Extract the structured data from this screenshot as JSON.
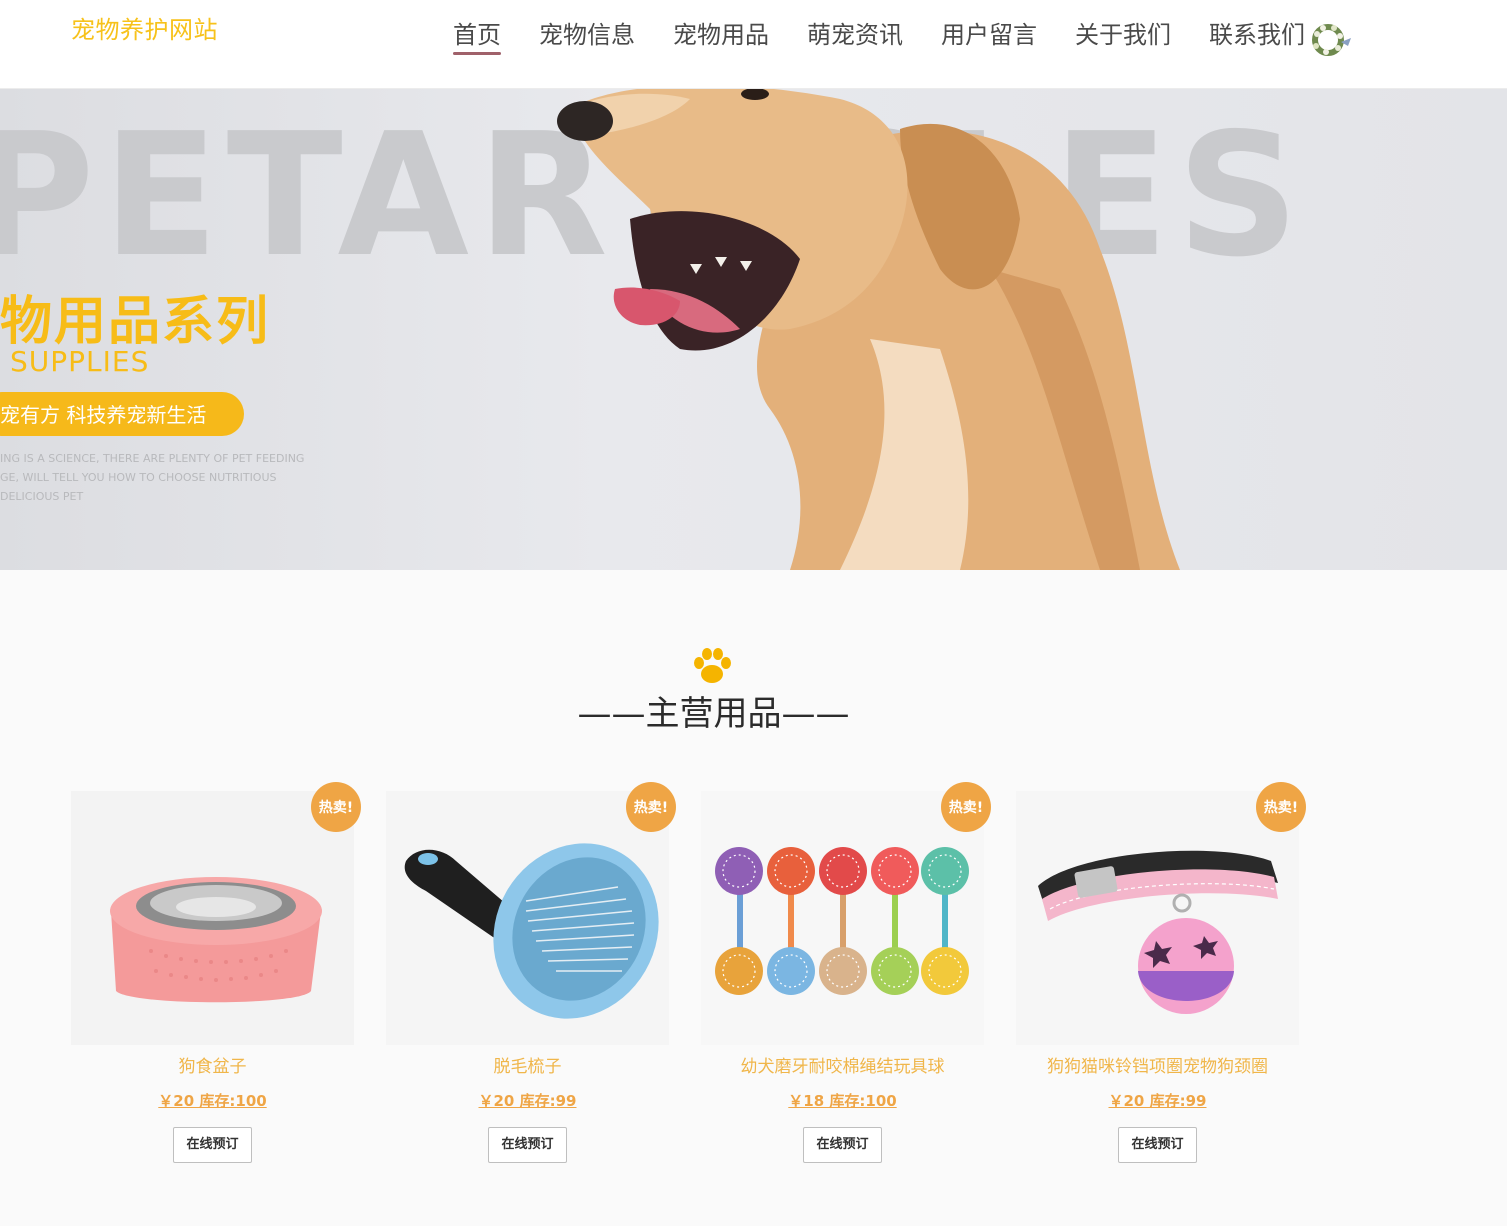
{
  "header": {
    "site_title": "宠物养护网站",
    "nav": [
      {
        "label": "首页",
        "active": true
      },
      {
        "label": "宠物信息",
        "active": false
      },
      {
        "label": "宠物用品",
        "active": false
      },
      {
        "label": "萌宠资讯",
        "active": false
      },
      {
        "label": "用户留言",
        "active": false
      },
      {
        "label": "关于我们",
        "active": false
      },
      {
        "label": "联系我们",
        "active": false
      }
    ]
  },
  "banner": {
    "big_word": "PETARTICLES",
    "cn_title": "物用品系列",
    "en_title": "SUPPLIES",
    "pill_text": "宠有方  科技养宠新生活",
    "small_lines": [
      "ING IS A SCIENCE, THERE ARE PLENTY OF PET FEEDING",
      "GE, WILL TELL YOU HOW TO CHOOSE NUTRITIOUS",
      "DELICIOUS PET"
    ]
  },
  "section": {
    "title": "——主营用品——"
  },
  "products": [
    {
      "name": "狗食盆子",
      "price_stock": "￥20 库存:100",
      "badge": "热卖!",
      "button": "在线预订"
    },
    {
      "name": "脱毛梳子",
      "price_stock": "￥20 库存:99",
      "badge": "热卖!",
      "button": "在线预订"
    },
    {
      "name": "幼犬磨牙耐咬棉绳结玩具球",
      "price_stock": "￥18 库存:100",
      "badge": "热卖!",
      "button": "在线预订"
    },
    {
      "name": "狗狗猫咪铃铛项圈宠物狗颈圈",
      "price_stock": "￥20 库存:99",
      "badge": "热卖!",
      "button": "在线预订"
    }
  ],
  "colors": {
    "brand_yellow": "#f7c21b",
    "badge_orange": "#efa545",
    "nav_underline": "#a0616a"
  }
}
